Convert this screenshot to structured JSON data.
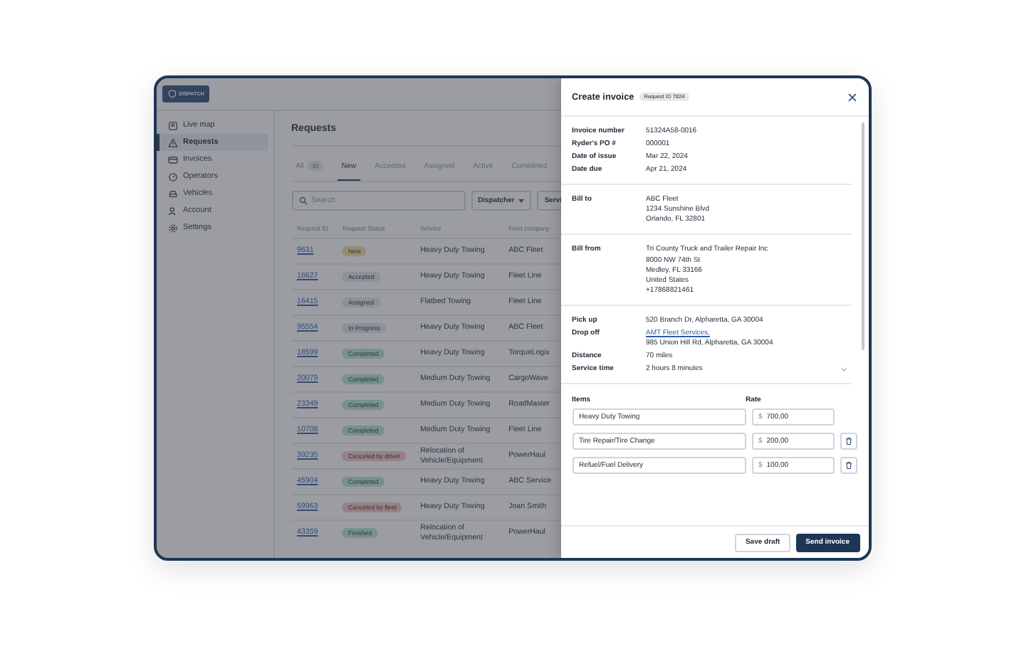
{
  "app": {
    "logo": "DISPATCH"
  },
  "sidebar": {
    "items": [
      {
        "label": "Live map",
        "selected": false
      },
      {
        "label": "Requests",
        "selected": true
      },
      {
        "label": "Invoices",
        "selected": false
      },
      {
        "label": "Operators",
        "selected": false
      },
      {
        "label": "Vehicles",
        "selected": false
      },
      {
        "label": "Account",
        "selected": false
      },
      {
        "label": "Settings",
        "selected": false
      }
    ]
  },
  "page": {
    "title": "Requests"
  },
  "tabs": [
    {
      "label": "All",
      "count": "10",
      "selected": false
    },
    {
      "label": "New",
      "selected": true
    },
    {
      "label": "Accepted",
      "selected": false
    },
    {
      "label": "Assigned",
      "selected": false
    },
    {
      "label": "Active",
      "selected": false
    },
    {
      "label": "Completed",
      "selected": false
    }
  ],
  "search": {
    "placeholder": "Search"
  },
  "filters": [
    {
      "label": "Dispatcher",
      "dropdown": true
    },
    {
      "label": "Servi",
      "dropdown": false
    }
  ],
  "table": {
    "columns": [
      "Request ID",
      "Request Status",
      "Service",
      "Fleet company"
    ],
    "rows": [
      {
        "id": "9631",
        "status": "New",
        "kind": "new",
        "service": "Heavy Duty Towing",
        "fleet": "ABC Fleet"
      },
      {
        "id": "16627",
        "status": "Accepted",
        "kind": "neutral",
        "service": "Heavy Duty Towing",
        "fleet": "Fleet Line"
      },
      {
        "id": "16415",
        "status": "Assigned",
        "kind": "neutral",
        "service": "Flatbed Towing",
        "fleet": "Fleet Line"
      },
      {
        "id": "95554",
        "status": "In Progress",
        "kind": "neutral",
        "service": "Heavy Duty Towing",
        "fleet": "ABC Fleet"
      },
      {
        "id": "18599",
        "status": "Completed",
        "kind": "success",
        "service": "Heavy Duty Towing",
        "fleet": "TorqueLogix"
      },
      {
        "id": "20079",
        "status": "Completed",
        "kind": "success",
        "service": "Medium Duty Towing",
        "fleet": "CargoWave"
      },
      {
        "id": "23349",
        "status": "Completed",
        "kind": "success",
        "service": "Medium Duty Towing",
        "fleet": "RoadMaster"
      },
      {
        "id": "10708",
        "status": "Completed",
        "kind": "success",
        "service": "Medium Duty Towing",
        "fleet": "Fleet Line"
      },
      {
        "id": "39235",
        "status": "Canceled by driver",
        "kind": "danger",
        "service": "Relocation of Vehicle/Equipment",
        "fleet": "PowerHaul"
      },
      {
        "id": "45904",
        "status": "Completed",
        "kind": "success",
        "service": "Heavy Duty Towing",
        "fleet": "ABC Service"
      },
      {
        "id": "59963",
        "status": "Canceled by fleet",
        "kind": "danger",
        "service": "Heavy Duty Towing",
        "fleet": "Joan Smith"
      },
      {
        "id": "43359",
        "status": "Finished",
        "kind": "success",
        "service": "Relocation of Vehicle/Equipment",
        "fleet": "PowerHaul"
      }
    ]
  },
  "drawer": {
    "title": "Create invoice",
    "badge": "Request ID 7824",
    "sections": [
      {
        "rows": [
          {
            "label": "Invoice number",
            "lines": [
              "51324A58-0016"
            ]
          },
          {
            "label": "Ryder's PO #",
            "lines": [
              "000001"
            ]
          },
          {
            "label": "Date of issue",
            "lines": [
              "Mar 22, 2024"
            ]
          },
          {
            "label": "Date due",
            "lines": [
              "Apr 21, 2024"
            ]
          }
        ]
      },
      {
        "rows": [
          {
            "label": "Bill to",
            "lines": [
              "ABC Fleet",
              "1234 Sunshine Blvd",
              "Orlando, FL 32801"
            ]
          }
        ]
      },
      {
        "rows": [
          {
            "label": "Bill from",
            "lines": [
              "Tri County Truck and Trailer Repair Inc",
              "8000 NW 74th St",
              "Medley, FL 33166",
              "United States",
              "+17868821461"
            ]
          }
        ]
      },
      {
        "rows": [
          {
            "label": "Pick up",
            "lines": [
              "520 Branch Dr, Alpharetta, GA 30004"
            ]
          },
          {
            "label": "Drop off",
            "link": "AMT Fleet Services,",
            "lines": [
              "985 Union Hill Rd, Alpharetta, GA 30004"
            ]
          },
          {
            "label": "Distance",
            "lines": [
              "70 miles"
            ]
          },
          {
            "label": "Service time",
            "lines": [
              "2 hours 8 minutes"
            ],
            "collapsible": true
          }
        ]
      }
    ],
    "items_header": "Items",
    "rate_header": "Rate",
    "items": [
      {
        "name": "Heavy Duty Towing",
        "currency": "$",
        "rate": "700,00",
        "removable": false
      },
      {
        "name": "Tire Repair/Tire Change",
        "currency": "$",
        "rate": "200,00",
        "removable": true
      },
      {
        "name": "Refuel/Fuel Delivery",
        "currency": "$",
        "rate": "100,00",
        "removable": true
      }
    ],
    "buttons": [
      {
        "label": "Save draft",
        "primary": false
      },
      {
        "label": "Send invoice",
        "primary": true
      }
    ]
  }
}
